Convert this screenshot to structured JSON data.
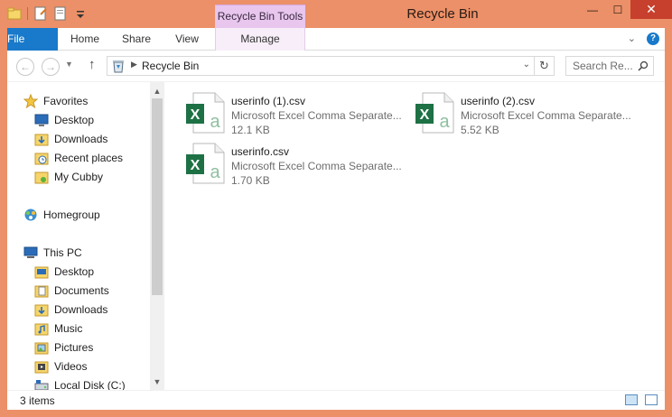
{
  "window": {
    "title": "Recycle Bin",
    "contextual_tab_group": "Recycle Bin Tools",
    "controls": {
      "minimize": "—",
      "maximize": "☐",
      "close": "✕"
    }
  },
  "ribbon": {
    "tabs": [
      {
        "label": "File"
      },
      {
        "label": "Home"
      },
      {
        "label": "Share"
      },
      {
        "label": "View"
      },
      {
        "label": "Manage"
      }
    ]
  },
  "address": {
    "path": "Recycle Bin",
    "search_placeholder": "Search Re..."
  },
  "navigation": {
    "favorites_label": "Favorites",
    "favorites": [
      {
        "label": "Desktop",
        "icon": "desktop-icon"
      },
      {
        "label": "Downloads",
        "icon": "downloads-folder-icon"
      },
      {
        "label": "Recent places",
        "icon": "recent-places-icon"
      },
      {
        "label": "My Cubby",
        "icon": "cubby-icon"
      }
    ],
    "homegroup_label": "Homegroup",
    "thispc_label": "This PC",
    "thispc": [
      {
        "label": "Desktop",
        "icon": "folder-icon"
      },
      {
        "label": "Documents",
        "icon": "documents-folder-icon"
      },
      {
        "label": "Downloads",
        "icon": "downloads-folder-icon"
      },
      {
        "label": "Music",
        "icon": "music-folder-icon"
      },
      {
        "label": "Pictures",
        "icon": "pictures-folder-icon"
      },
      {
        "label": "Videos",
        "icon": "videos-folder-icon"
      },
      {
        "label": "Local Disk (C:)",
        "icon": "local-disk-icon"
      }
    ]
  },
  "files": [
    {
      "name": "userinfo (1).csv",
      "type": "Microsoft Excel Comma Separate...",
      "size": "12.1 KB"
    },
    {
      "name": "userinfo (2).csv",
      "type": "Microsoft Excel Comma Separate...",
      "size": "5.52 KB"
    },
    {
      "name": "userinfo.csv",
      "type": "Microsoft Excel Comma Separate...",
      "size": "1.70 KB"
    }
  ],
  "status": {
    "item_count": "3 items"
  },
  "colors": {
    "titlebar": "#eb9068",
    "file_tab": "#1979ca",
    "contextual_tab": "#e8c6ee",
    "close_button": "#c7402d",
    "excel_green": "#1e7145"
  }
}
